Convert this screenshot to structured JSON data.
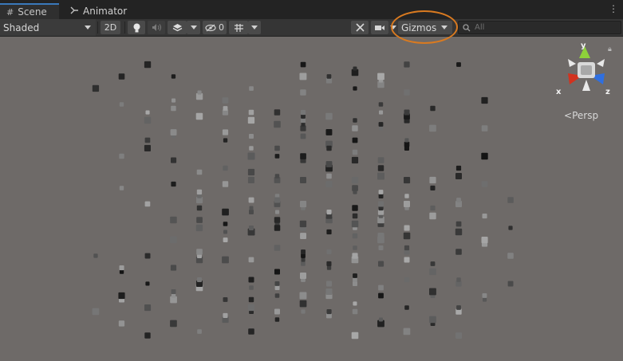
{
  "tabs": {
    "scene": "Scene",
    "animator": "Animator"
  },
  "toolbar": {
    "draw_mode": "Shaded",
    "mode_2d": "2D",
    "hidden_count": "0",
    "gizmos": "Gizmos"
  },
  "search": {
    "placeholder": "All"
  },
  "gizmo": {
    "y": "y",
    "x": "x",
    "z": "z",
    "projection": "Persp"
  },
  "colors": {
    "highlight": "#d97a20",
    "y_axis": "#8ed13a",
    "x_axis": "#d2321e",
    "z_axis": "#2f6fe0",
    "background": "#6e6a68"
  },
  "icons": [
    "grid-icon",
    "animator-icon",
    "kebab-icon",
    "lighting-icon",
    "audio-icon",
    "effects-icon",
    "visibility-icon",
    "grid-toggle-icon",
    "tools-icon",
    "camera-icon",
    "search-icon",
    "lock-icon"
  ]
}
